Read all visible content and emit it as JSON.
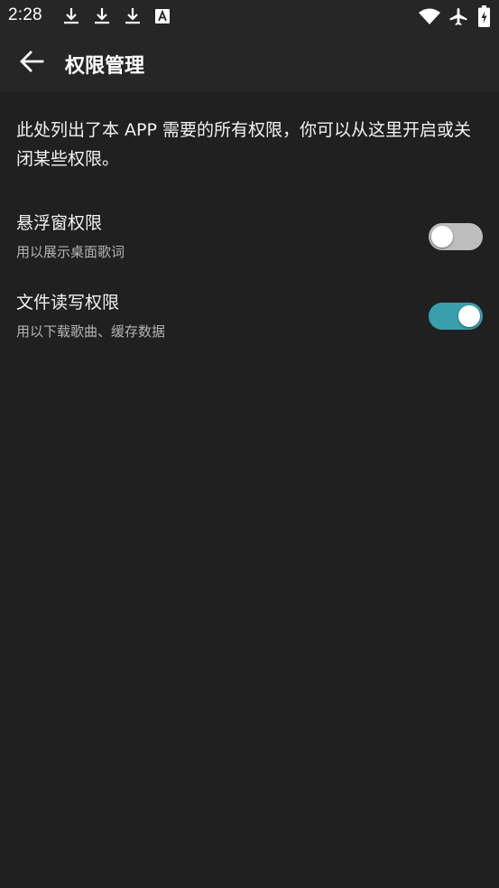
{
  "status_bar": {
    "time": "2:28",
    "icons": [
      "download-icon",
      "download-icon",
      "download-icon",
      "font-a-icon",
      "wifi-icon",
      "airplane-icon",
      "battery-charging-icon"
    ]
  },
  "app_bar": {
    "back_icon": "arrow-left-icon",
    "title": "权限管理"
  },
  "description": "此处列出了本 APP 需要的所有权限，你可以从这里开启或关闭某些权限。",
  "permissions": [
    {
      "title": "悬浮窗权限",
      "subtitle": "用以展示桌面歌词",
      "enabled": false
    },
    {
      "title": "文件读写权限",
      "subtitle": "用以下载歌曲、缓存数据",
      "enabled": true
    }
  ],
  "colors": {
    "background": "#202020",
    "bars": "#262626",
    "switch_on": "#3a9fac",
    "switch_off": "#bdbdbd"
  }
}
